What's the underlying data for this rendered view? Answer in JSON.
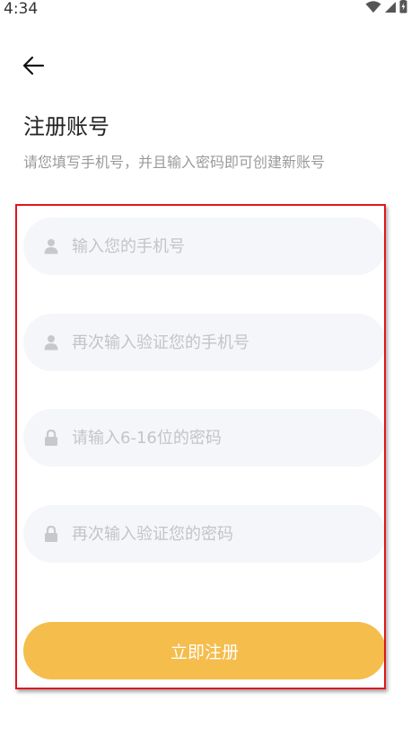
{
  "status_bar": {
    "time": "4:34",
    "icons": [
      "wifi-icon",
      "cell-signal-icon",
      "battery-icon"
    ]
  },
  "header": {
    "back_icon": "arrow-left-icon",
    "title": "注册账号",
    "subtitle": "请您填写手机号，并且输入密码即可创建新账号"
  },
  "form": {
    "phone": {
      "icon": "user-icon",
      "value": "",
      "placeholder": "输入您的手机号"
    },
    "phone_confirm": {
      "icon": "user-icon",
      "value": "",
      "placeholder": "再次输入验证您的手机号"
    },
    "password": {
      "icon": "lock-icon",
      "value": "",
      "placeholder": "请输入6-16位的密码"
    },
    "password_confirm": {
      "icon": "lock-icon",
      "value": "",
      "placeholder": "再次输入验证您的密码"
    },
    "submit_label": "立即注册"
  },
  "colors": {
    "accent": "#f4bd4c",
    "field_bg": "#f5f6fa",
    "placeholder": "#c4c4c6",
    "highlight_border": "#e0161e"
  }
}
